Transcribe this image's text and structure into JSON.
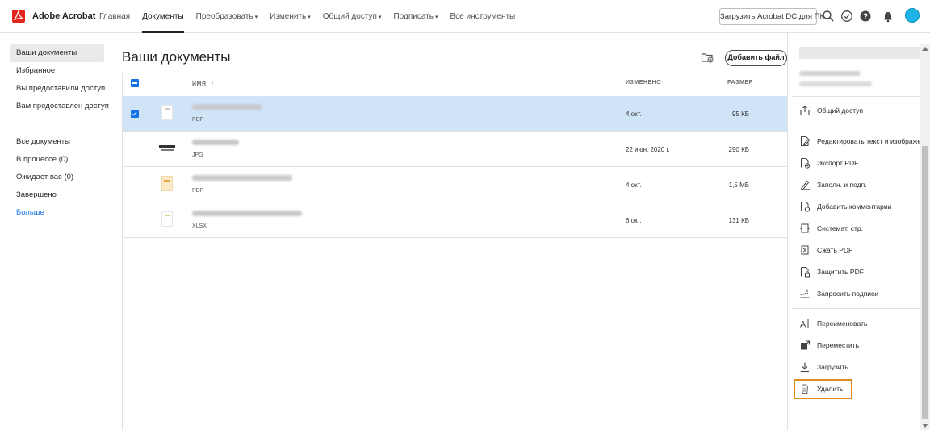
{
  "app": {
    "brand": "Adobe Acrobat"
  },
  "nav": {
    "items": [
      {
        "label": "Главная",
        "dropdown": false,
        "active": false
      },
      {
        "label": "Документы",
        "dropdown": false,
        "active": true
      },
      {
        "label": "Преобразовать",
        "dropdown": true,
        "active": false
      },
      {
        "label": "Изменить",
        "dropdown": true,
        "active": false
      },
      {
        "label": "Общий доступ",
        "dropdown": true,
        "active": false
      },
      {
        "label": "Подписать",
        "dropdown": true,
        "active": false
      },
      {
        "label": "Все инструменты",
        "dropdown": false,
        "active": false
      }
    ],
    "download_button": "Загрузить Acrobat DC для ПК",
    "icons": [
      "search-icon",
      "check-circle-icon",
      "help-icon",
      "bell-icon",
      "avatar"
    ]
  },
  "sidebar": {
    "items": [
      {
        "label": "Ваши документы",
        "active": true
      },
      {
        "label": "Избранное"
      },
      {
        "label": "Вы предоставили доступ"
      },
      {
        "label": "Вам предоставлен доступ"
      }
    ],
    "status_items": [
      {
        "label": "Все документы"
      },
      {
        "label": "В процессе (0)"
      },
      {
        "label": "Ожидает вас (0)"
      },
      {
        "label": "Завершено"
      },
      {
        "label": "Больше"
      }
    ]
  },
  "main": {
    "title": "Ваши документы",
    "add_file_button": "Добавить файл",
    "columns": {
      "name": "ИМЯ",
      "sort_indicator": "↑",
      "modified": "ИЗМЕНЕНО",
      "size": "РАЗМЕР"
    },
    "rows": [
      {
        "type": "PDF",
        "modified": "4 окт.",
        "size": "95 КБ",
        "selected": true
      },
      {
        "type": "JPG",
        "modified": "22 июн. 2020 г.",
        "size": "290 КБ",
        "selected": false
      },
      {
        "type": "PDF",
        "modified": "4 окт.",
        "size": "1,5 МБ",
        "selected": false
      },
      {
        "type": "XLSX",
        "modified": "6 окт.",
        "size": "131 КБ",
        "selected": false
      }
    ]
  },
  "right_panel": {
    "share": "Общий доступ",
    "tools": [
      {
        "label": "Редактировать текст и изображения",
        "icon": "edit-pdf-icon"
      },
      {
        "label": "Экспорт PDF",
        "icon": "export-pdf-icon"
      },
      {
        "label": "Заполн. и подп.",
        "icon": "fill-sign-icon"
      },
      {
        "label": "Добавить комментарии",
        "icon": "comment-icon"
      },
      {
        "label": "Системат. стр.",
        "icon": "organize-pages-icon"
      },
      {
        "label": "Сжать PDF",
        "icon": "compress-pdf-icon"
      },
      {
        "label": "Защитить PDF",
        "icon": "protect-pdf-icon"
      },
      {
        "label": "Запросить подписи",
        "icon": "request-signatures-icon"
      }
    ],
    "actions": [
      {
        "label": "Переименовать",
        "icon": "rename-icon"
      },
      {
        "label": "Переместить",
        "icon": "move-icon"
      },
      {
        "label": "Загрузить",
        "icon": "download-icon"
      },
      {
        "label": "Удалить",
        "icon": "trash-icon",
        "highlighted": true
      }
    ]
  },
  "colors": {
    "accent": "#1473e6",
    "selected_row": "#d0e4f8",
    "brand": "#e0241b",
    "highlight": "#e08a1e"
  }
}
